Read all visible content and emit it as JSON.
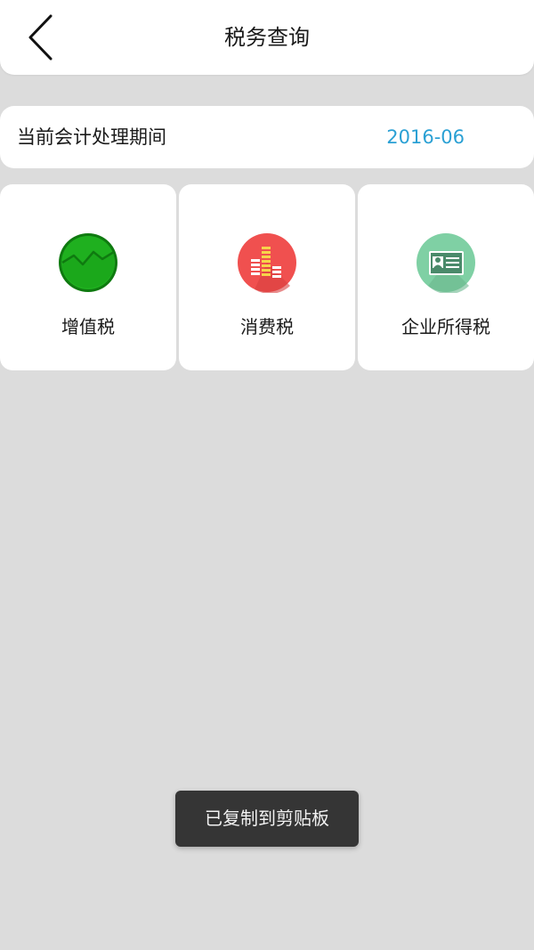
{
  "header": {
    "title": "税务查询",
    "back_icon": "chevron-left-icon"
  },
  "period": {
    "label": "当前会计处理期间",
    "value": "2016-06",
    "value_color": "#2aa0d4"
  },
  "tiles": [
    {
      "label": "增值税",
      "icon": "vat-chart-icon",
      "color": "#1fb01f"
    },
    {
      "label": "消费税",
      "icon": "consumption-bars-icon",
      "color": "#f0504f"
    },
    {
      "label": "企业所得税",
      "icon": "id-card-icon",
      "color": "#7fd0a4"
    }
  ],
  "toast": {
    "message": "已复制到剪贴板"
  }
}
